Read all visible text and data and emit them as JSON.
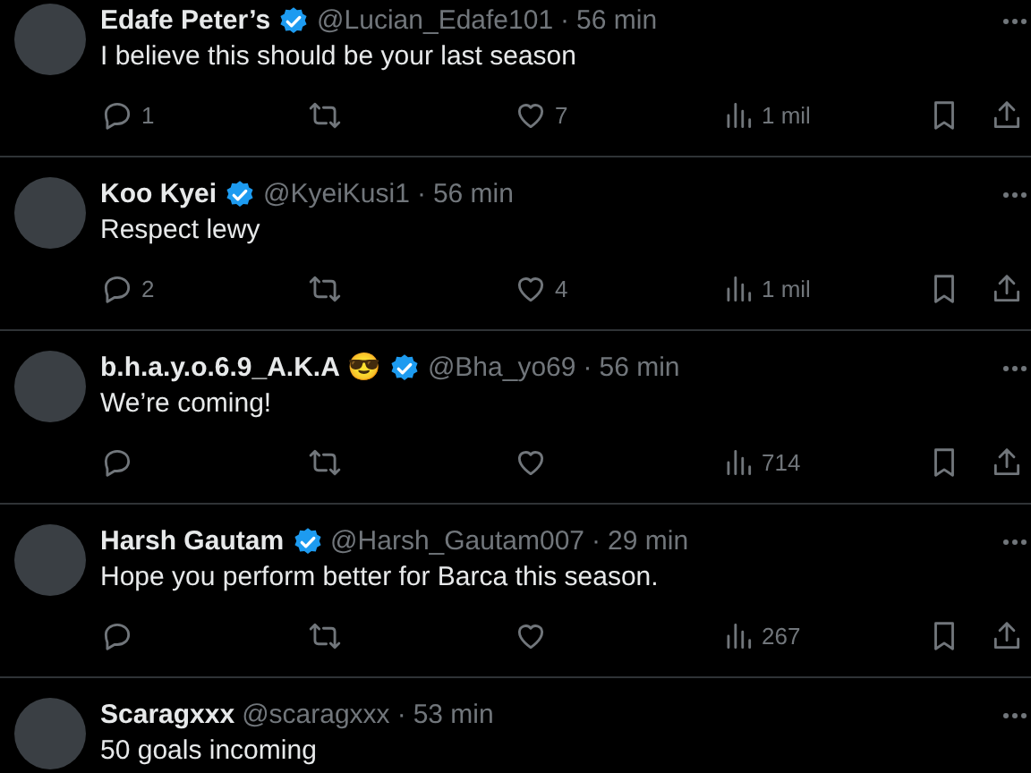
{
  "replies": [
    {
      "name": "Edafe Peter’s",
      "verified": true,
      "handle": "@Lucian_Edafe101",
      "separator": "·",
      "time": "56 min",
      "text": "I believe this should be your last season",
      "reply_count": "1",
      "like_count": "7",
      "views": "1 mil"
    },
    {
      "name": "Koo Kyei",
      "verified": true,
      "handle": "@KyeiKusi1",
      "separator": "·",
      "time": "56 min",
      "text": "Respect lewy",
      "reply_count": "2",
      "like_count": "4",
      "views": "1 mil"
    },
    {
      "name": "b.h.a.y.o.6.9_A.K.A",
      "name_emoji": "😎",
      "verified": true,
      "handle": "@Bha_yo69",
      "separator": "·",
      "time": "56 min",
      "text": "We’re coming!",
      "views": "714"
    },
    {
      "name": "Harsh Gautam",
      "verified": true,
      "handle": "@Harsh_Gautam007",
      "separator": "·",
      "time": "29 min",
      "text": "Hope you perform better for Barca this season.",
      "views": "267"
    },
    {
      "name": "Scaragxxx",
      "verified": false,
      "handle": "@scaragxxx",
      "separator": "·",
      "time": "53 min",
      "text": "50 goals incoming"
    }
  ]
}
